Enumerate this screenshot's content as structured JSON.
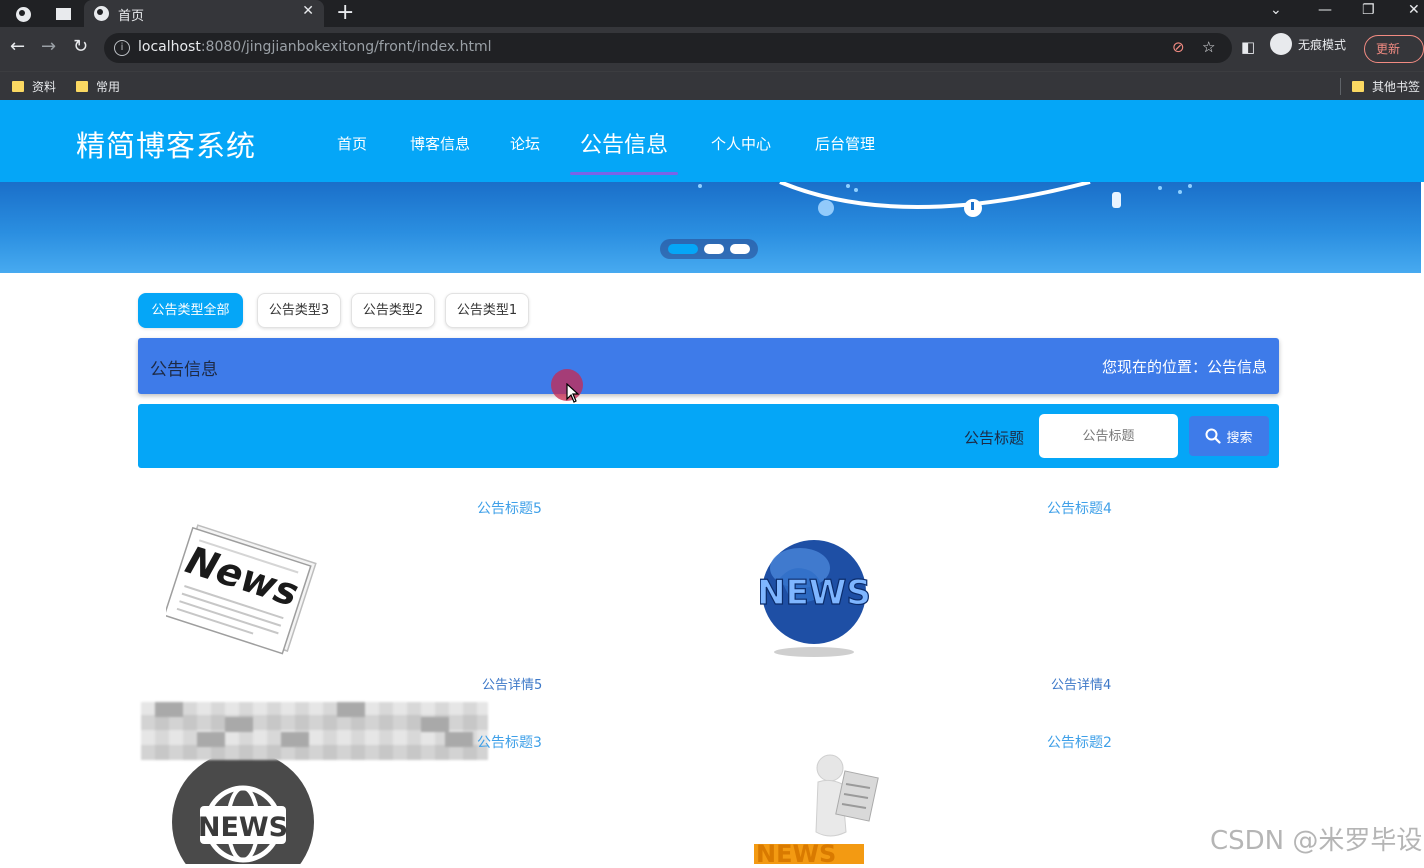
{
  "browser": {
    "tab_title": "首页",
    "url_host": "localhost",
    "url_path": ":8080/jingjianbokexitong/front/index.html",
    "incognito_label": "无痕模式",
    "update_label": "更新",
    "bookmarks": [
      "资料",
      "常用"
    ],
    "other_bookmarks": "其他书签"
  },
  "site": {
    "logo": "精简博客系统",
    "nav": [
      "首页",
      "博客信息",
      "论坛",
      "公告信息",
      "个人中心",
      "后台管理"
    ],
    "active_nav": "公告信息"
  },
  "banner": {
    "slide_count": 3,
    "active_slide": 1
  },
  "filters": [
    "公告类型全部",
    "公告类型3",
    "公告类型2",
    "公告类型1"
  ],
  "active_filter": "公告类型全部",
  "breadcrumb": {
    "title": "公告信息",
    "position": "您现在的位置：公告信息"
  },
  "search": {
    "label": "公告标题",
    "placeholder": "公告标题",
    "button": "搜索"
  },
  "notices": [
    {
      "title": "公告标题5",
      "detail": "公告详情5",
      "image": "newspaper-news"
    },
    {
      "title": "公告标题4",
      "detail": "公告详情4",
      "image": "globe-news"
    },
    {
      "title": "公告标题3",
      "detail": "",
      "image": "circle-news-badge"
    },
    {
      "title": "公告标题2",
      "detail": "",
      "image": "figure-reading-news"
    }
  ],
  "watermark": "CSDN @米罗毕设",
  "colors": {
    "header": "#05a6f7",
    "breadcrumb_bar": "#3e7be9",
    "search_bar": "#05a6f7",
    "title_link": "#3fa0e8"
  }
}
